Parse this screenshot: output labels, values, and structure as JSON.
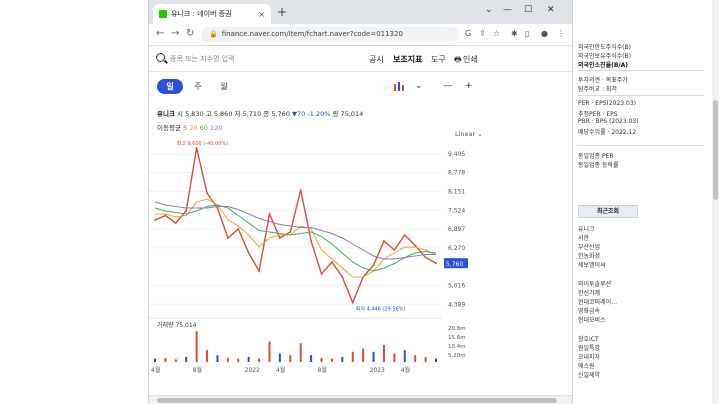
{
  "browser": {
    "tab_title": "유니크 : 네이버 증권",
    "tab_close": "×",
    "new_tab": "+",
    "window_controls": [
      "⌄",
      "—",
      "☐",
      "✕"
    ],
    "nav": [
      "←",
      "→",
      "↻"
    ],
    "url": "finance.naver.com/item/fchart.naver?code=011320",
    "extensions": [
      "G",
      "⇪",
      "☆",
      "✱",
      "▯",
      "●",
      "⋮"
    ]
  },
  "search": {
    "placeholder": "종목 또는 지수명 입력",
    "menu": [
      "공시",
      "보조지표",
      "도구",
      "인쇄"
    ]
  },
  "periods": [
    "일",
    "주",
    "월"
  ],
  "ohlc": {
    "name": "유니크",
    "open_label": "시",
    "open": "5,830",
    "high_label": "고",
    "high": "5,860",
    "low_label": "저",
    "low": "5,710",
    "close_label": "종",
    "close": "5,760",
    "change": "▼70",
    "change_pct": "-1.20%",
    "volume_label": "량",
    "volume": "75,014"
  },
  "moving_avg": {
    "label": "이동평균",
    "v1": "5",
    "v2": "20",
    "v3": "60",
    "v4": "120"
  },
  "scale_mode": "Linear ⌄",
  "chart_data": {
    "type": "line",
    "title": "",
    "y_ticks": [
      "9,405",
      "8,778",
      "8,151",
      "7,524",
      "6,897",
      "6,270",
      "5,016",
      "4,389"
    ],
    "current_price": "5,760",
    "high_annotation": "최고 9,600 (-40.00%)",
    "low_annotation": "최저 4,446 (29.56%)",
    "x_ticks": [
      "4월",
      "8월",
      "2022",
      "4월",
      "8월",
      "2023",
      "4월"
    ],
    "ylim": [
      4200,
      9700
    ],
    "x": [
      "2021-04",
      "2021-05",
      "2021-06",
      "2021-07",
      "2021-08",
      "2021-09",
      "2021-10",
      "2021-11",
      "2021-12",
      "2022-01",
      "2022-02",
      "2022-03",
      "2022-04",
      "2022-05",
      "2022-06",
      "2022-07",
      "2022-08",
      "2022-09",
      "2022-10",
      "2022-11",
      "2022-12",
      "2023-01",
      "2023-02",
      "2023-03",
      "2023-04",
      "2023-05",
      "2023-06",
      "2023-07"
    ],
    "series": [
      {
        "values": [
          7200,
          7350,
          7100,
          7500,
          9600,
          8100,
          7600,
          6600,
          6900,
          6100,
          5500,
          7400,
          6600,
          6800,
          8200,
          6500,
          5400,
          5800,
          5300,
          4446,
          5300,
          5700,
          6500,
          6200,
          6700,
          6350,
          5950,
          5760
        ],
        "color": "#d94b3a"
      },
      {
        "values": [
          7400,
          7400,
          7300,
          7350,
          7800,
          7900,
          7700,
          7200,
          7000,
          6700,
          6300,
          6600,
          6700,
          6700,
          7000,
          6900,
          6200,
          5900,
          5600,
          5300,
          5300,
          5500,
          5900,
          6100,
          6300,
          6300,
          6200,
          6050
        ],
        "color": "#e8a23a"
      },
      {
        "values": [
          7600,
          7500,
          7450,
          7400,
          7500,
          7650,
          7700,
          7600,
          7350,
          7100,
          6850,
          6800,
          6750,
          6700,
          6750,
          6800,
          6650,
          6400,
          6100,
          5800,
          5600,
          5500,
          5600,
          5750,
          5950,
          6100,
          6150,
          6100
        ],
        "color": "#3fae5a"
      },
      {
        "values": [
          7800,
          7700,
          7650,
          7600,
          7600,
          7600,
          7650,
          7650,
          7550,
          7400,
          7250,
          7150,
          7050,
          7000,
          6950,
          6950,
          6850,
          6750,
          6600,
          6400,
          6200,
          6000,
          5900,
          5900,
          5950,
          6000,
          6050,
          6050
        ],
        "color": "#8c79c6"
      }
    ]
  },
  "volume": {
    "label": "거래량",
    "value": "75,014",
    "ticks": [
      "20.8m",
      "15.6m",
      "10.4m",
      "5.20m"
    ],
    "bars": [
      0.1,
      0.12,
      0.08,
      0.15,
      0.9,
      0.35,
      0.2,
      0.12,
      0.1,
      0.15,
      0.1,
      0.6,
      0.25,
      0.2,
      0.55,
      0.2,
      0.12,
      0.1,
      0.15,
      0.3,
      0.4,
      0.3,
      0.5,
      0.25,
      0.35,
      0.2,
      0.15,
      0.1
    ]
  },
  "right_panel": {
    "top_items": [
      "외국인한도주식수(B)",
      "외국인보유주식수(B)",
      "외국인소진율(B/A)"
    ],
    "opinion": [
      "투자의견 · 목표주가",
      "탐주비교 : 최저"
    ],
    "ratios": [
      {
        "label": "PER · EPS(2023.03)"
      },
      {
        "label": "추정PER · EPS"
      },
      {
        "label": "PBR · BPS (2023.03)"
      },
      {
        "label": "배당수익률 · 2022.12"
      }
    ],
    "industry": [
      "동일업종 PER",
      "동일업종 등락률"
    ],
    "recent_header": "최근조회",
    "recent": [
      "유니크",
      "서한",
      "부산산업",
      "한농화성",
      "세보엠이씨",
      "와이투솔루션",
      "한신기계",
      "현대코퍼레이…",
      "영화금속",
      "현대모비스",
      "창호ICT",
      "원일특강",
      "오내피자",
      "에스원",
      "신일제약"
    ]
  }
}
